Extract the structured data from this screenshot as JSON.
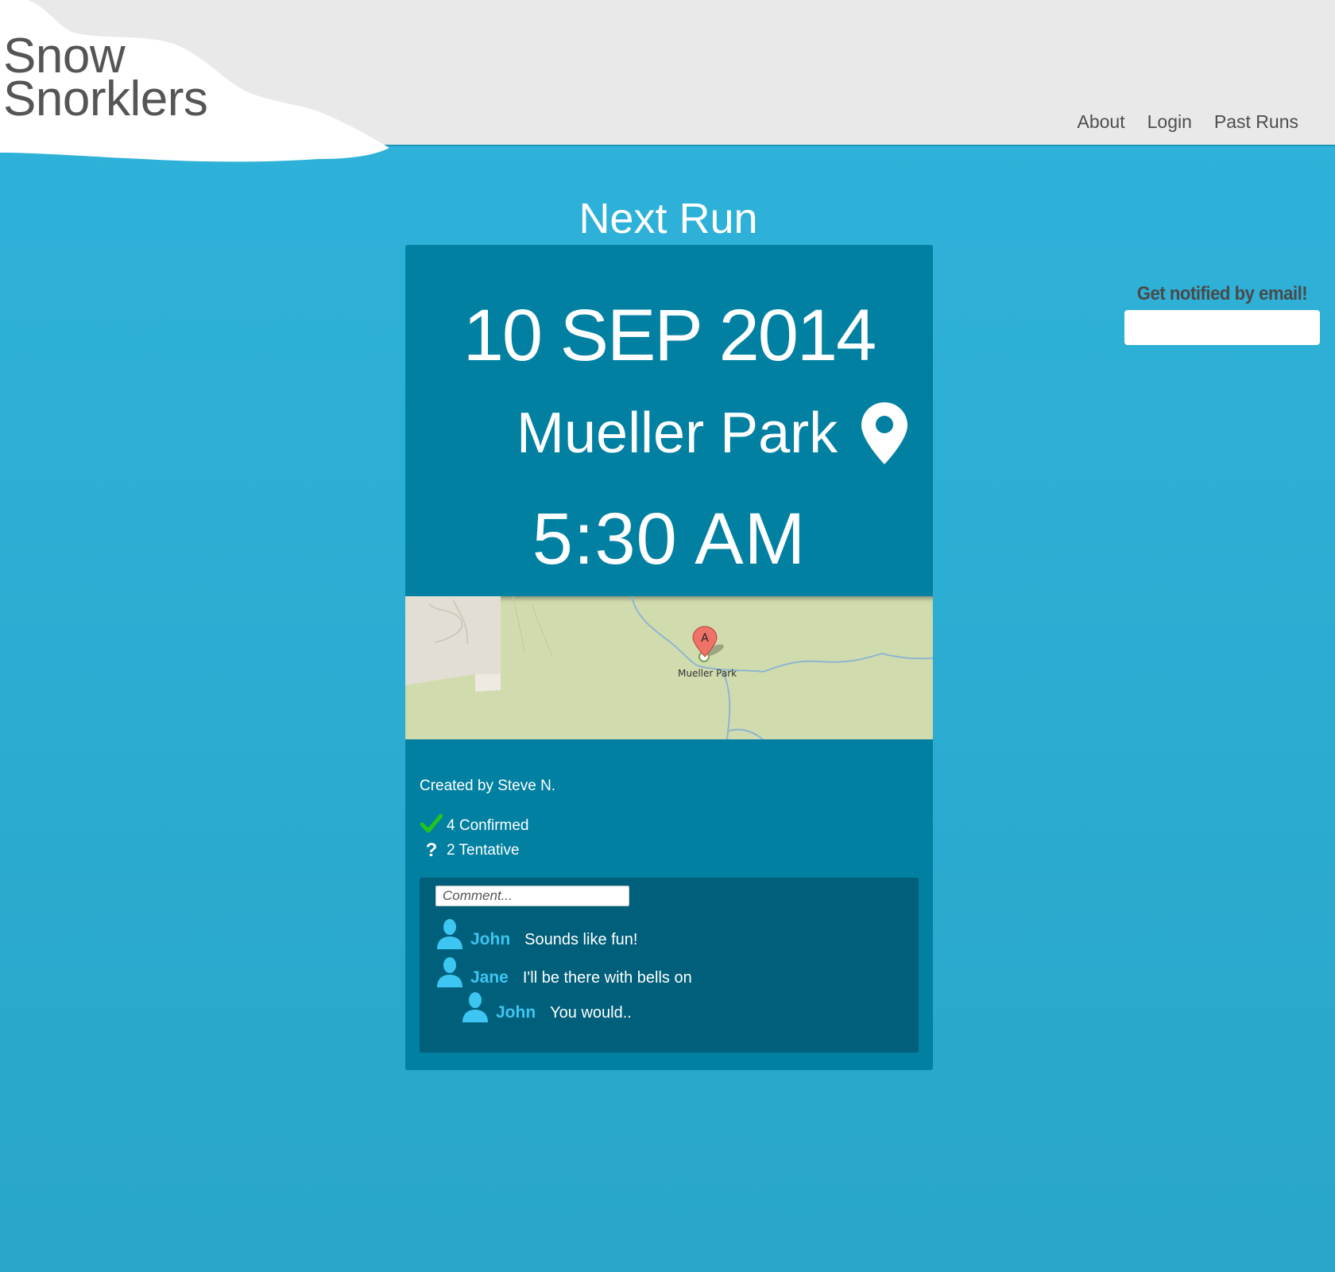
{
  "header": {
    "logo_line1": "Snow",
    "logo_line2": "Snorklers",
    "nav": {
      "about": "About",
      "login": "Login",
      "past_runs": "Past Runs"
    }
  },
  "main": {
    "title": "Next Run",
    "run": {
      "date": "10 SEP 2014",
      "location": "Mueller Park",
      "time": "5:30 AM",
      "map_marker_letter": "A",
      "map_place_label": "Mueller Park",
      "created_by": "Created by Steve N.",
      "confirmed": "4 Confirmed",
      "tentative": "2 Tentative"
    },
    "comments": {
      "placeholder": "Comment...",
      "items": [
        {
          "name": "John",
          "text": "Sounds like fun!"
        },
        {
          "name": "Jane",
          "text": "I'll be there with bells on"
        },
        {
          "name": "John",
          "text": "You would.."
        }
      ]
    }
  },
  "notify": {
    "label": "Get notified by email!",
    "value": ""
  },
  "colors": {
    "background": "#2fb3db",
    "header_bg": "#e9e9e9",
    "card_bg": "#0180a2",
    "comments_bg": "#005f7a",
    "commenter_name": "#3cc6f1",
    "confirmed_check": "#22c51e",
    "map_bg": "#d1dcae"
  },
  "icons": {
    "location": "location-pin-icon",
    "confirmed": "checkmark-icon",
    "tentative": "question-mark-icon",
    "avatar": "user-icon"
  }
}
